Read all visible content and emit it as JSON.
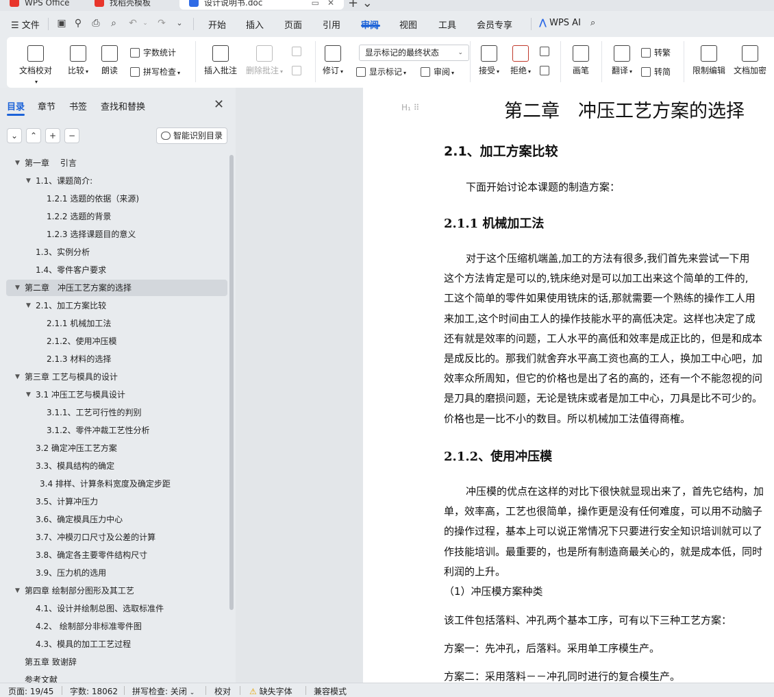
{
  "titlebar": {
    "tabs": [
      {
        "label": "WPS Office",
        "icon": "wps-logo-icon",
        "color": "#e8352b"
      },
      {
        "label": "找稻壳模板",
        "icon": "docer-icon",
        "color": "#e8352b"
      },
      {
        "label": "设计说明书.doc",
        "icon": "word-doc-icon",
        "color": "#2f6be6"
      }
    ]
  },
  "menubar": {
    "file": "文件",
    "tabs": [
      "开始",
      "插入",
      "页面",
      "引用",
      "审阅",
      "视图",
      "工具",
      "会员专享"
    ],
    "active_tab": "审阅",
    "ai": "WPS AI"
  },
  "ribbon": {
    "doc_check": "文档校对",
    "compare": "比较",
    "read_aloud": "朗读",
    "word_count": "字数统计",
    "spell_check": "拼写检查",
    "insert_comment": "插入批注",
    "delete_comment": "删除批注",
    "track_changes": "修订",
    "markup_mode": "显示标记的最终状态",
    "show_markup": "显示标记",
    "review_pane": "审阅",
    "accept": "接受",
    "reject": "拒绝",
    "ink": "画笔",
    "translate": "翻译",
    "to_traditional": "转繁",
    "to_simplified": "转简",
    "restrict_edit": "限制编辑",
    "encrypt_doc": "文档加密"
  },
  "navpane": {
    "tabs": [
      "目录",
      "章节",
      "书签",
      "查找和替换"
    ],
    "active_tab": "目录",
    "smart_toc": "智能识别目录",
    "controls": [
      "⌄",
      "⌃",
      "+",
      "−"
    ],
    "toc": [
      {
        "label": "第一章　 引言",
        "level": 1,
        "expanded": true
      },
      {
        "label": "1.1、课题简介:",
        "level": 2,
        "expanded": true
      },
      {
        "label": "1.2.1 选题的依据（来源)",
        "level": 3
      },
      {
        "label": "1.2.2 选题的背景",
        "level": 3
      },
      {
        "label": "1.2.3 选择课题目的意义",
        "level": 3
      },
      {
        "label": "1.3、实例分析",
        "level": 2
      },
      {
        "label": "1.4、零件客户要求",
        "level": 2
      },
      {
        "label": "第二章　冲压工艺方案的选择",
        "level": 1,
        "expanded": true,
        "selected": true
      },
      {
        "label": "2.1、加工方案比较",
        "level": 2,
        "expanded": true
      },
      {
        "label": "2.1.1 机械加工法",
        "level": 3
      },
      {
        "label": "2.1.2、使用冲压模",
        "level": 3
      },
      {
        "label": "2.1.3 材料的选择",
        "level": 3
      },
      {
        "label": "第三章  工艺与模具的设计",
        "level": 1,
        "expanded": true
      },
      {
        "label": "3.1 冲压工艺与模具设计",
        "level": 2,
        "expanded": true
      },
      {
        "label": "3.1.1、工艺可行性的判别",
        "level": 3
      },
      {
        "label": "3.1.2、零件冲裁工艺性分析",
        "level": 3
      },
      {
        "label": "3.2 确定冲压工艺方案",
        "level": 2
      },
      {
        "label": "3.3、模具结构的确定",
        "level": 2
      },
      {
        "label": "3.4 排样、计算条料宽度及确定步距",
        "level": 2,
        "indent_extra": true
      },
      {
        "label": "3.5、计算冲压力",
        "level": 2
      },
      {
        "label": "3.6、确定模具压力中心",
        "level": 2
      },
      {
        "label": "3.7、冲模刃口尺寸及公差的计算",
        "level": 2
      },
      {
        "label": "3.8、确定各主要零件结构尺寸",
        "level": 2
      },
      {
        "label": "3.9、压力机的选用",
        "level": 2
      },
      {
        "label": "第四章  绘制部分图形及其工艺",
        "level": 1,
        "expanded": true
      },
      {
        "label": "4.1、设计并绘制总图、选取标准件",
        "level": 2
      },
      {
        "label": "4.2、 绘制部分非标准零件图",
        "level": 2
      },
      {
        "label": "4.3、模具的加工工艺过程",
        "level": 2
      },
      {
        "label": "第五章  致谢辞",
        "level": 1
      },
      {
        "label": "参考文献",
        "level": 1
      }
    ]
  },
  "document": {
    "chapter_title": "第二章　冲压工艺方案的选择",
    "h2_1": "2.1、加工方案比较",
    "intro": "下面开始讨论本课题的制造方案：",
    "h3_1": "2.1.1 机械加工法",
    "para1": [
      "对于这个压缩机端盖,加工的方法有很多,我们首先来尝试一下用",
      "这个方法肯定是可以的,铣床绝对是可以加工出来这个简单的工件的,",
      "工这个简单的零件如果使用铣床的话,那就需要一个熟练的操作工人用",
      "来加工,这个时间由工人的操作技能水平的高低决定。这样也决定了成",
      "还有就是效率的问题，工人水平的高低和效率是成正比的，但是和成本",
      "是成反比的。那我们就舍弃水平高工资也高的工人，换加工中心吧，加",
      "效率众所周知，但它的价格也是出了名的高的，还有一个不能忽视的问",
      "是刀具的磨损问题，无论是铣床或者是加工中心，刀具是比不可少的。",
      "价格也是一比不小的数目。所以机械加工法值得商榷。"
    ],
    "h3_2": "2.1.2、使用冲压模",
    "para2": [
      "冲压模的优点在这样的对比下很快就显现出来了，首先它结构，加",
      "单，效率高，工艺也很简单，操作更是没有任何难度，可以用不动脑子",
      "的操作过程，基本上可以说正常情况下只要进行安全知识培训就可以了",
      "作技能培训。最重要的，也是所有制造商最关心的，就是成本低，同时",
      "利润的上升。"
    ],
    "sub1": "（1）冲压模方案种类",
    "line1": "该工件包括落料、冲孔两个基本工序，可有以下三种工艺方案：",
    "line2": "方案一：先冲孔，后落料。采用单工序模生产。",
    "line3": "方案二：采用落料－－冲孔同时进行的复合模生产。"
  },
  "statusbar": {
    "page": "页面: 19/45",
    "words": "字数: 18062",
    "spell": "拼写检查: 关闭",
    "proof": "校对",
    "missing_font": "缺失字体",
    "compat": "兼容模式"
  }
}
